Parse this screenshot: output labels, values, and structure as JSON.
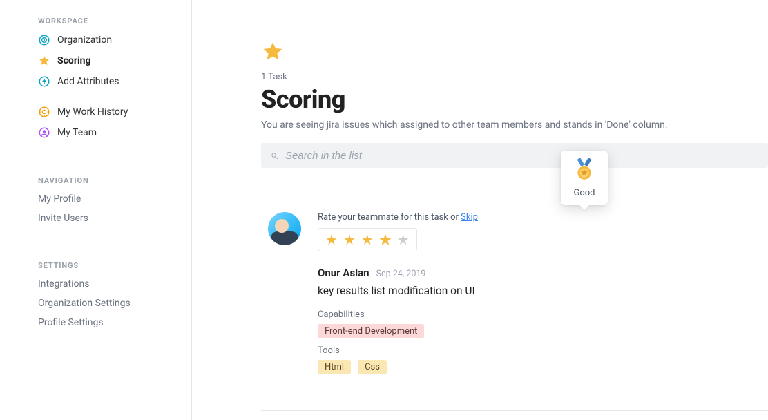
{
  "sidebar": {
    "groups": [
      {
        "heading": "WORKSPACE",
        "items": [
          {
            "label": "Organization",
            "icon": "target",
            "color": "#0ea5c4"
          },
          {
            "label": "Scoring",
            "icon": "star",
            "color": "#f5b93e",
            "active": true
          },
          {
            "label": "Add Attributes",
            "icon": "up-circle",
            "color": "#0ea5c4"
          },
          {
            "label": "My Work History",
            "icon": "gear-badge",
            "color": "#f59e0b"
          },
          {
            "label": "My Team",
            "icon": "person-circle",
            "color": "#a855f7"
          }
        ]
      },
      {
        "heading": "NAVIGATION",
        "plain": true,
        "items": [
          {
            "label": "My Profile"
          },
          {
            "label": "Invite Users"
          }
        ]
      },
      {
        "heading": "SETTINGS",
        "plain": true,
        "items": [
          {
            "label": "Integrations"
          },
          {
            "label": "Organization Settings"
          },
          {
            "label": "Profile Settings"
          }
        ]
      }
    ]
  },
  "header": {
    "task_count": "1 Task",
    "title": "Scoring",
    "subtitle": "You are seeing jira issues which assigned to other team members and stands in 'Done' column."
  },
  "search": {
    "placeholder": "Search in the list"
  },
  "tooltip": {
    "label": "Good"
  },
  "task": {
    "rate_prefix": "Rate your teammate for this task or ",
    "skip_label": "Skip",
    "rating": 4,
    "author": "Onur Aslan",
    "date": "Sep 24, 2019",
    "title": "key results list modification on UI",
    "capabilities_label": "Capabilities",
    "capabilities": [
      "Front-end Development"
    ],
    "tools_label": "Tools",
    "tools": [
      "Html",
      "Css"
    ]
  }
}
